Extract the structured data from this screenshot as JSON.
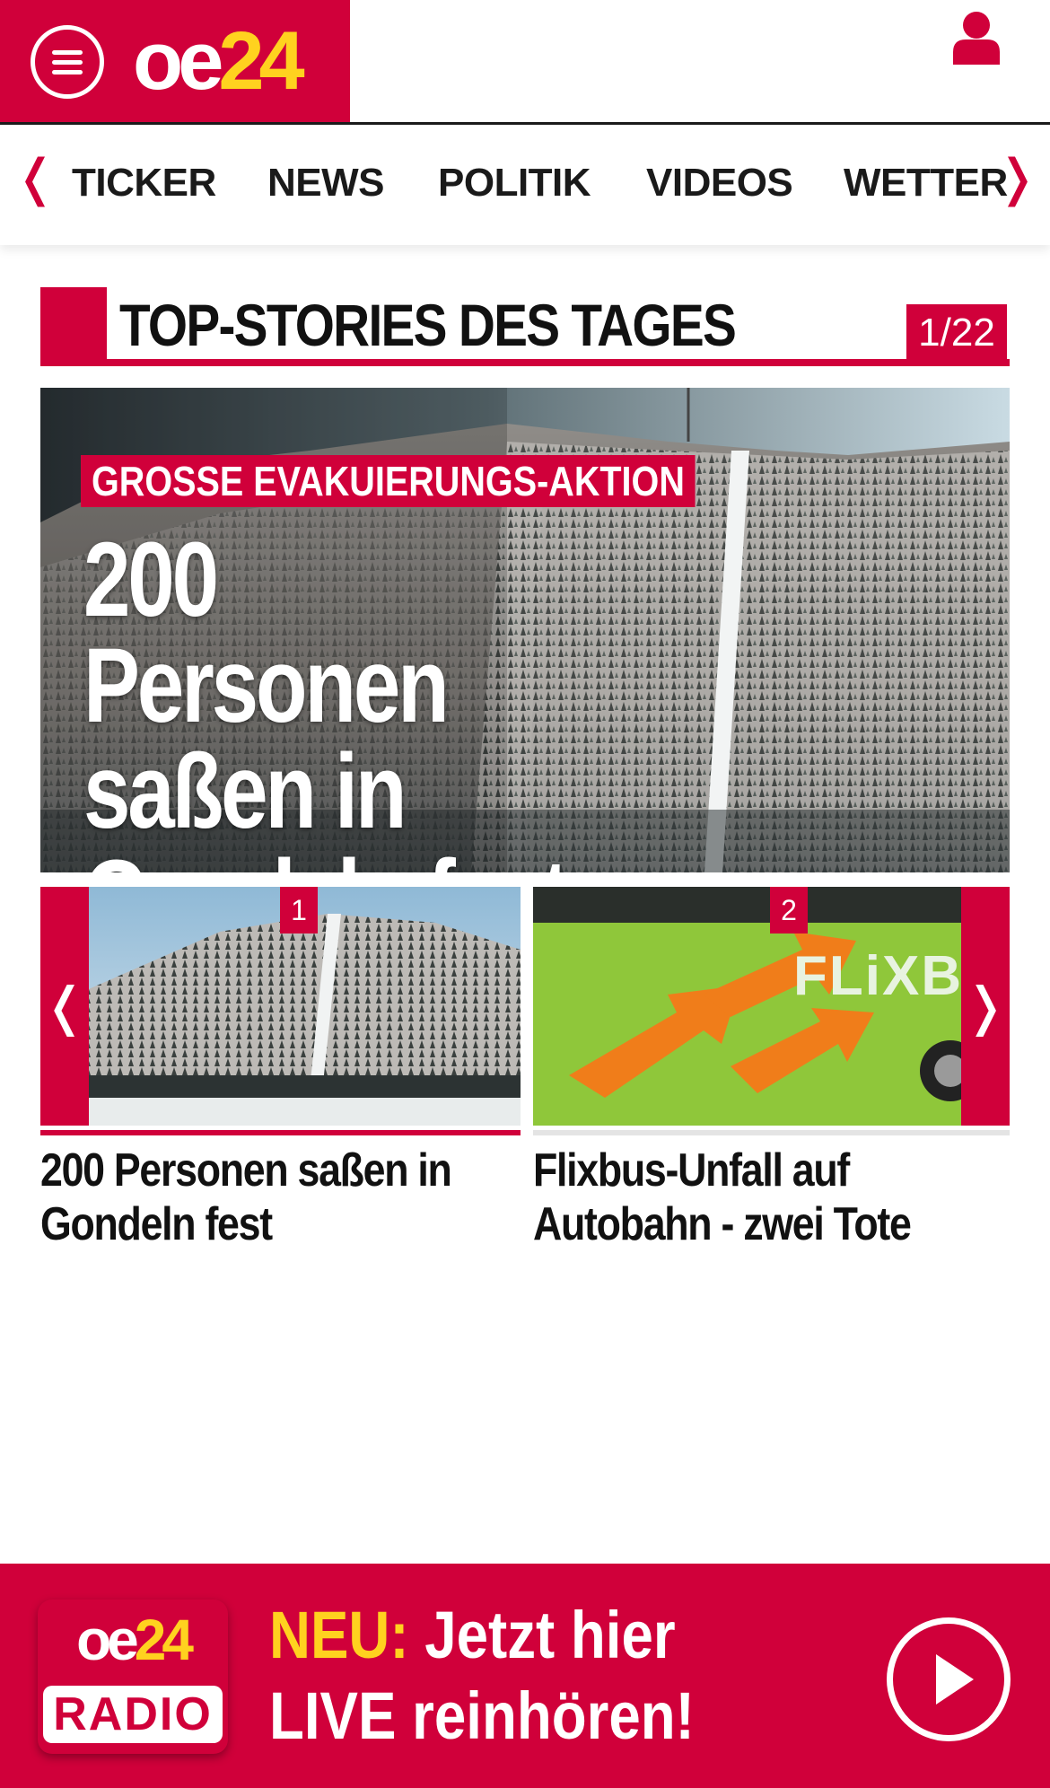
{
  "header": {
    "logo_oe": "oe",
    "logo_num": "24"
  },
  "nav": {
    "items": [
      "TICKER",
      "NEWS",
      "POLITIK",
      "VIDEOS",
      "WETTER"
    ]
  },
  "section": {
    "title": "TOP-STORIES DES TAGES",
    "counter": "1/22"
  },
  "hero": {
    "kicker": "GROSSE EVAKUIERUNGS-AKTION",
    "title_lines": [
      "200 Personen",
      "saßen in",
      "Gondeln fest"
    ]
  },
  "carousel": {
    "cards": [
      {
        "num": "1",
        "title": "200 Personen saßen in Gondeln fest"
      },
      {
        "num": "2",
        "title": "Flixbus-Unfall auf Autobahn - zwei Tote",
        "image_text": "FLiXBUS"
      }
    ]
  },
  "radio": {
    "logo_oe": "oe",
    "logo_num": "24",
    "logo_label": "RADIO",
    "highlight": "NEU:",
    "line1_rest": " Jetzt hier",
    "line2": "LIVE reinhören!"
  },
  "colors": {
    "brand_red": "#d0003a",
    "brand_yellow": "#ffd21f"
  }
}
